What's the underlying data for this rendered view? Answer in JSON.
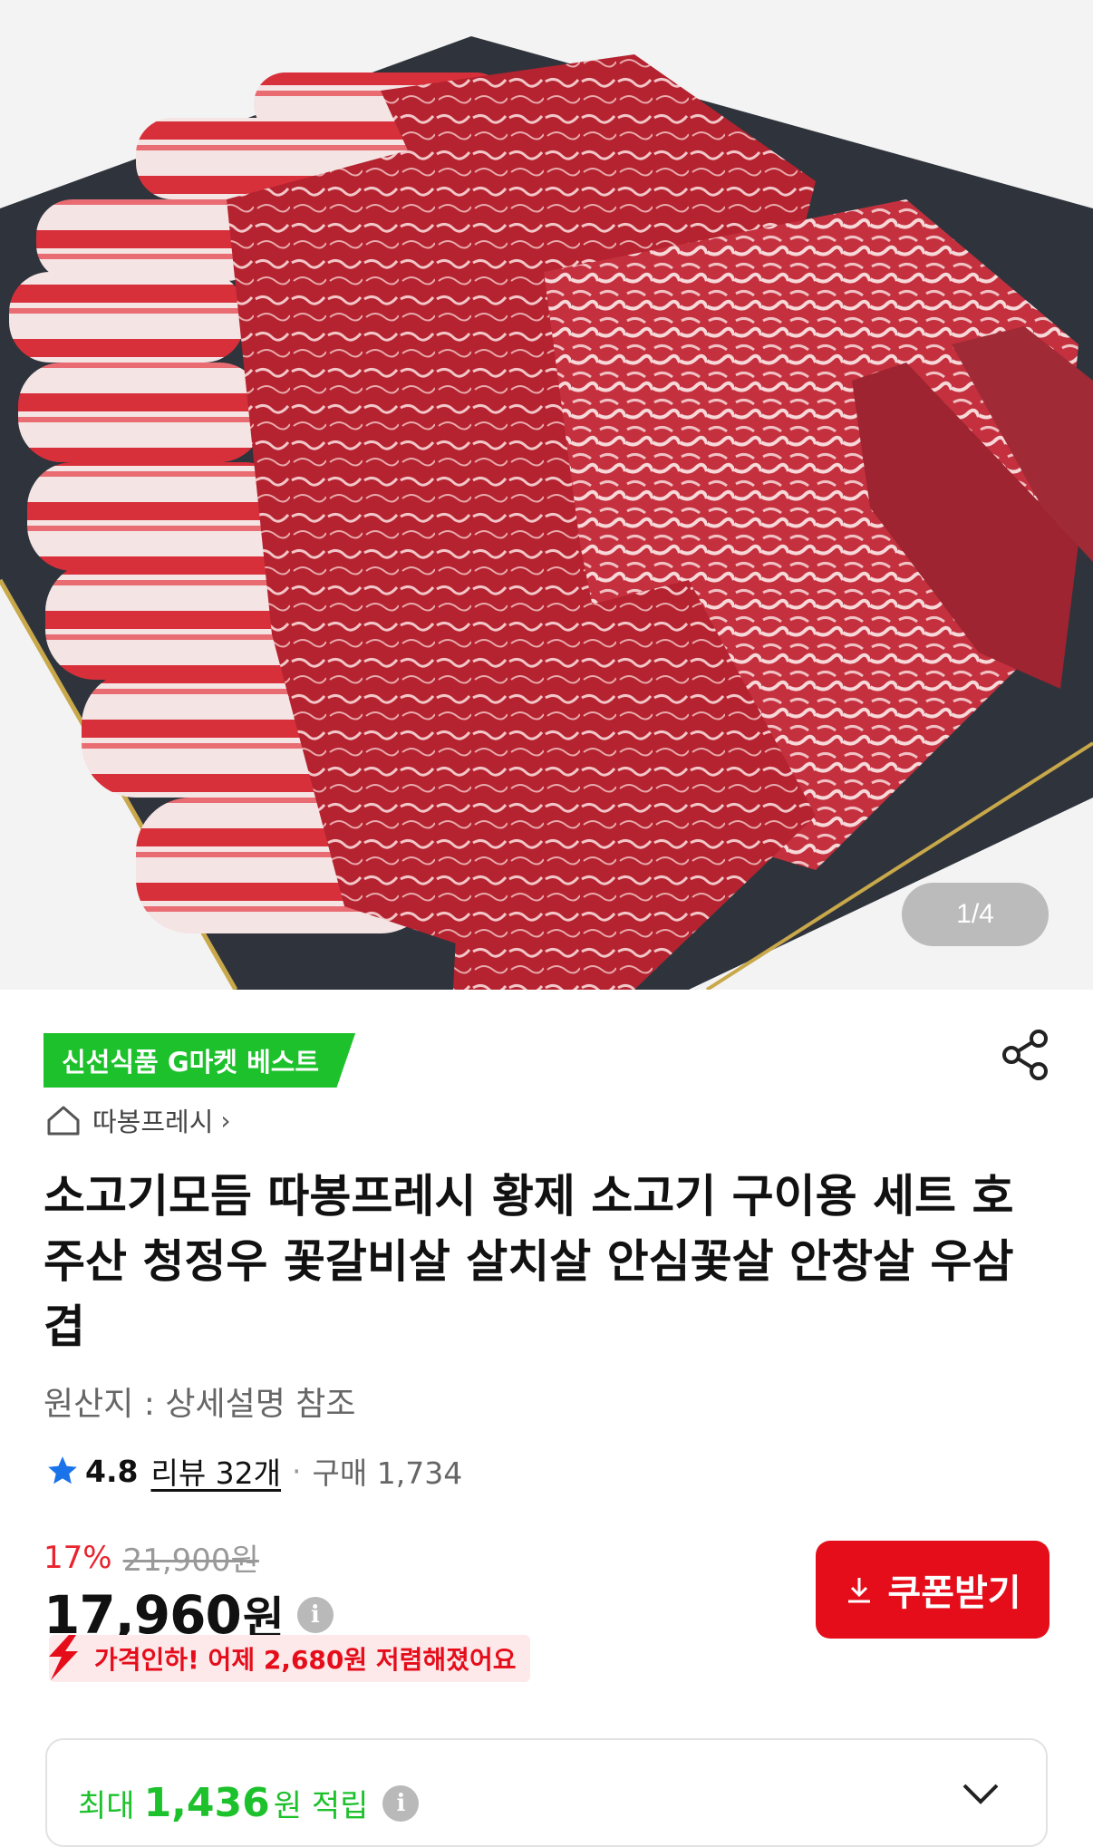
{
  "gallery": {
    "current": "1",
    "separator": "/",
    "total": "4"
  },
  "product": {
    "badge": "신선식품 G마켓 베스트",
    "shop_name": "따봉프레시",
    "title": "소고기모듬 따봉프레시 황제 소고기 구이용 세트 호주산 청정우 꽃갈비살 살치살 안심꽃살 안창살 우삼겹",
    "origin": "원산지 : 상세설명 참조"
  },
  "rating": {
    "score": "4.8",
    "reviews": "리뷰 32개",
    "sold": "구매 1,734"
  },
  "price": {
    "discount_pct": "17%",
    "original": "21,900원",
    "current": "17,960",
    "currency": "원",
    "info_icon": "i"
  },
  "coupon": {
    "label": "쿠폰받기"
  },
  "price_drop": {
    "text": "가격인하! 어제 2,680원 저렴해졌어요"
  },
  "points": {
    "prefix": "최대",
    "amount": "1,436",
    "suffix": "원 적립",
    "info_icon": "i"
  },
  "colors": {
    "badge_green": "#1dc12c",
    "accent_red": "#e50d1a",
    "discount_red": "#e8242e"
  },
  "icons": {
    "share": "share-icon",
    "home": "home-icon",
    "star": "star-icon",
    "download": "download-icon",
    "chevron": "chevron-down-icon"
  }
}
